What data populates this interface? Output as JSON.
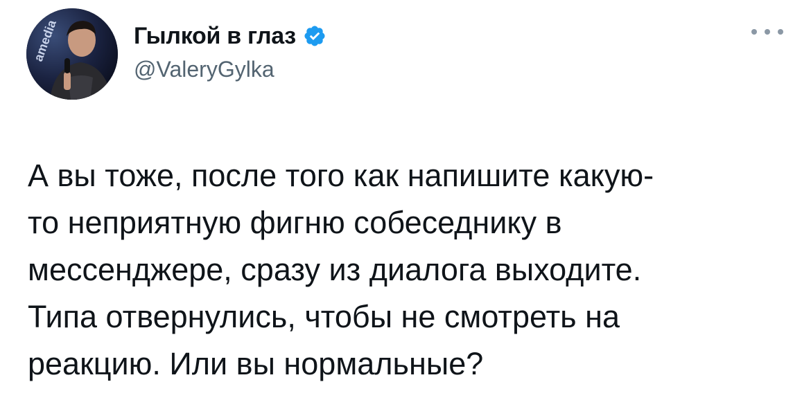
{
  "tweet": {
    "author": {
      "display_name": "Гылкой в глаз",
      "handle": "@ValeryGylka",
      "verified": true,
      "avatar_text": "amedia"
    },
    "more_icon": "more-horizontal-icon",
    "text_lines": [
      "А вы тоже, после того как напишите какую-",
      "то неприятную фигню собеседнику в",
      "мессенджере, сразу из диалога выходите.",
      "Типа отвернулись, чтобы не смотреть на",
      "реакцию. Или вы нормальные?"
    ]
  },
  "colors": {
    "text": "#0f1419",
    "secondary": "#536471",
    "verified": "#1d9bf0"
  }
}
